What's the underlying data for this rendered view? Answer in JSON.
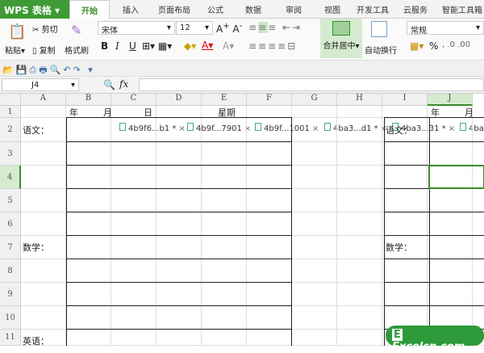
{
  "app": {
    "name": "WPS 表格"
  },
  "tabs": [
    "开始",
    "插入",
    "页面布局",
    "公式",
    "数据",
    "审阅",
    "视图",
    "开发工具",
    "云服务",
    "智能工具箱"
  ],
  "ribbon": {
    "paste": "粘贴",
    "cut": "剪切",
    "copy": "复制",
    "format_painter": "格式刷",
    "font": "宋体",
    "size": "12",
    "merge": "合并居中",
    "wrap": "自动换行",
    "number_format": "常规",
    "bold": "B",
    "italic": "I",
    "underline": "U",
    "percent": "%"
  },
  "files": [
    "4b9f6...b1 *",
    "4b9f...7901",
    "4b9f...1001",
    "4ba3...d1 *",
    "4ba3...31 *",
    "4ba"
  ],
  "formula_bar": {
    "cell_ref": "J4",
    "fx": "fx",
    "value": ""
  },
  "columns": [
    "A",
    "B",
    "C",
    "D",
    "E",
    "F",
    "G",
    "H",
    "I",
    "J"
  ],
  "rows": [
    "1",
    "2",
    "3",
    "4",
    "5",
    "6",
    "7",
    "8",
    "9",
    "10",
    "11"
  ],
  "cells": {
    "year": "年",
    "month": "月",
    "day": "日",
    "week": "星期",
    "chinese": "语文：",
    "math": "数学：",
    "english": "英语：",
    "year2": "年",
    "month2": "月",
    "chinese2": "语文：",
    "math2": "数学："
  },
  "selected_cell": "J4",
  "watermark": "Excelcn.com",
  "colors": {
    "accent": "#3f9b35"
  }
}
